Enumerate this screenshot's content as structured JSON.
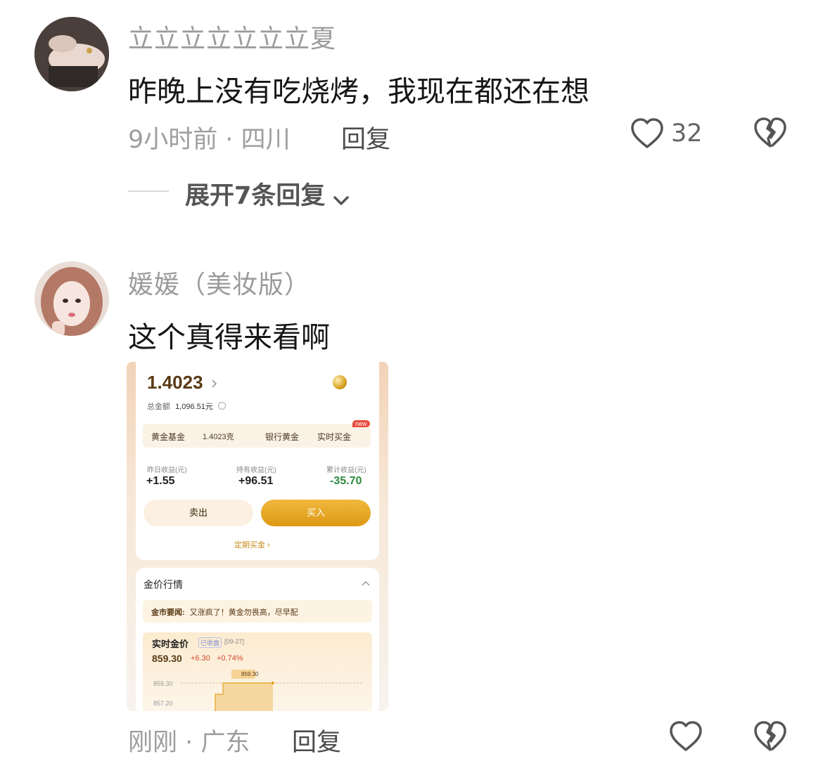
{
  "comments": [
    {
      "username": "立立立立立立立夏",
      "text": "昨晚上没有吃烧烤，我现在都还在想",
      "meta": "9小时前 · 四川",
      "reply_label": "回复",
      "like_count": "32",
      "expand_label": "展开7条回复"
    },
    {
      "username": "媛媛（美妆版）",
      "text": "这个真得来看啊",
      "meta": "刚刚 · 广东",
      "reply_label": "回复"
    }
  ],
  "embedded": {
    "grams": "1.4023",
    "total_label": "总金额",
    "total_value": "1,096.51元",
    "tab_fund": "黄金基金",
    "tab_fund_value": "1.4023克",
    "tab_bank": "银行黄金",
    "tab_realtime": "实时买金",
    "new_badge": "new",
    "yesterday_label": "昨日收益(元)",
    "yesterday_value": "+1.55",
    "holding_label": "持有收益(元)",
    "holding_value": "+96.51",
    "cumulative_label": "累计收益(元)",
    "cumulative_value": "-35.70",
    "sell_label": "卖出",
    "buy_label": "买入",
    "regular_label": "定期买金",
    "market_title": "金价行情",
    "news_prefix": "金市要闻:",
    "news_text": "又涨疯了！黄金勿畏高，尽早配",
    "price_title": "实时金价",
    "closed_badge": "已收盘",
    "date": "[09-27]",
    "price": "859.30",
    "change": "+6.30",
    "change_pct": "+0.74%",
    "tooltip_price": "859.30",
    "tick_high": "859.30",
    "tick_low": "857.20"
  },
  "colors": {
    "gold": "#e3a21f",
    "up": "#d24a2c",
    "down": "#2b8a3e"
  }
}
